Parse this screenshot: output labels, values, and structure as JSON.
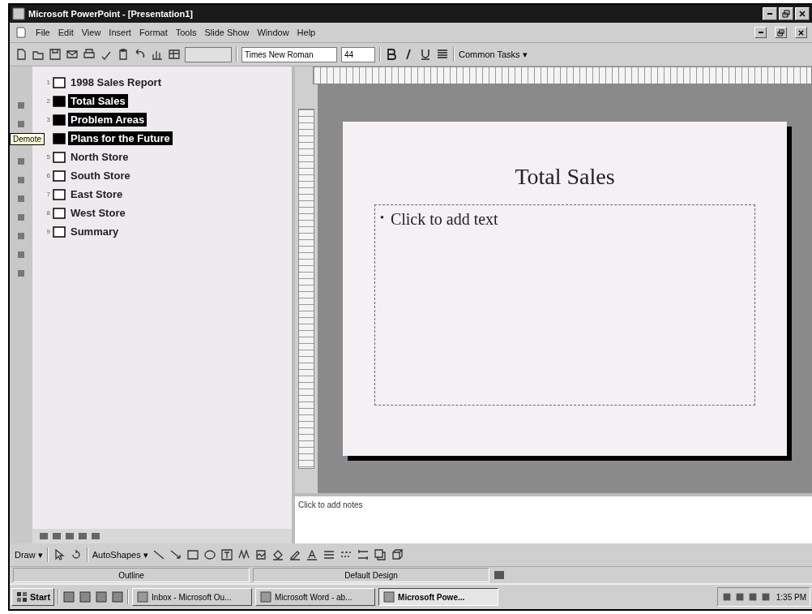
{
  "window": {
    "title": "Microsoft PowerPoint - [Presentation1]"
  },
  "menu": [
    "File",
    "Edit",
    "View",
    "Insert",
    "Format",
    "Tools",
    "Slide Show",
    "Window",
    "Help"
  ],
  "toolbar": {
    "font": "Times New Roman",
    "size": "44",
    "common_tasks": "Common Tasks ▾"
  },
  "outline": {
    "items": [
      {
        "number": "1",
        "title": "1998 Sales Report",
        "selected": false
      },
      {
        "number": "2",
        "title": "Total Sales",
        "selected": true
      },
      {
        "number": "3",
        "title": "Problem Areas",
        "selected": true
      },
      {
        "title": "Plans for the Future",
        "selected": true
      },
      {
        "number": "5",
        "title": "North Store",
        "selected": false
      },
      {
        "number": "6",
        "title": "South Store",
        "selected": false
      },
      {
        "number": "7",
        "title": "East Store",
        "selected": false
      },
      {
        "number": "8",
        "title": "West Store",
        "selected": false
      },
      {
        "number": "9",
        "title": "Summary",
        "selected": false
      }
    ]
  },
  "tooltip": "Demote",
  "slide": {
    "title": "Total Sales",
    "bullet": "•",
    "body": "Click to add text"
  },
  "notes": {
    "prompt": "Click to add notes"
  },
  "drawing_toolbar": {
    "draw": "Draw ▾",
    "autoshapes": "AutoShapes ▾"
  },
  "status_bar": [
    "Outline",
    "Default Design"
  ],
  "taskbar": {
    "start": "Start",
    "tasks": [
      {
        "label": "Inbox - Microsoft Ou...",
        "selected": false
      },
      {
        "label": "Microsoft Word - ab...",
        "selected": false
      },
      {
        "label": "Microsoft Powe...",
        "selected": true
      }
    ],
    "clock": "1:35 PM"
  }
}
